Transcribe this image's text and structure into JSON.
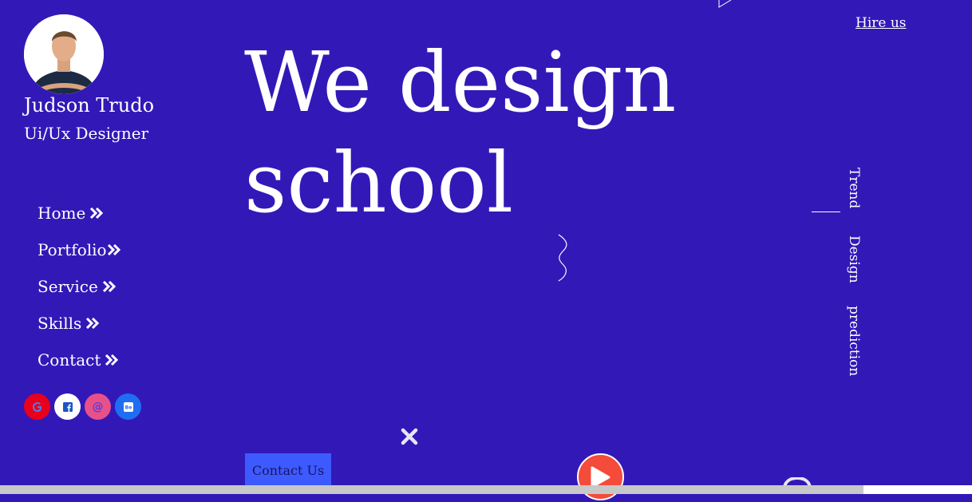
{
  "profile": {
    "name": "Judson Trudo",
    "role": "Ui/Ux Designer"
  },
  "nav": {
    "items": [
      {
        "label": "Home"
      },
      {
        "label": "Portfolio"
      },
      {
        "label": "Service"
      },
      {
        "label": "Skills"
      },
      {
        "label": "Contact"
      }
    ]
  },
  "social": [
    {
      "icon": "google-icon",
      "color": "#e8001c"
    },
    {
      "icon": "facebook-icon",
      "color": "#ffffff"
    },
    {
      "icon": "email-icon",
      "color": "#e8508a"
    },
    {
      "icon": "behance-icon",
      "color": "#1f6ef2"
    }
  ],
  "hero": {
    "line1": "We design",
    "line2": "school"
  },
  "header": {
    "hire_label": "Hire us"
  },
  "side_words": [
    "Trend",
    "Design",
    "prediction"
  ],
  "cta": {
    "contact_label": "Contact Us"
  },
  "colors": {
    "background": "#3318b8",
    "button": "#3d5afe",
    "play": "#f44b3a"
  }
}
